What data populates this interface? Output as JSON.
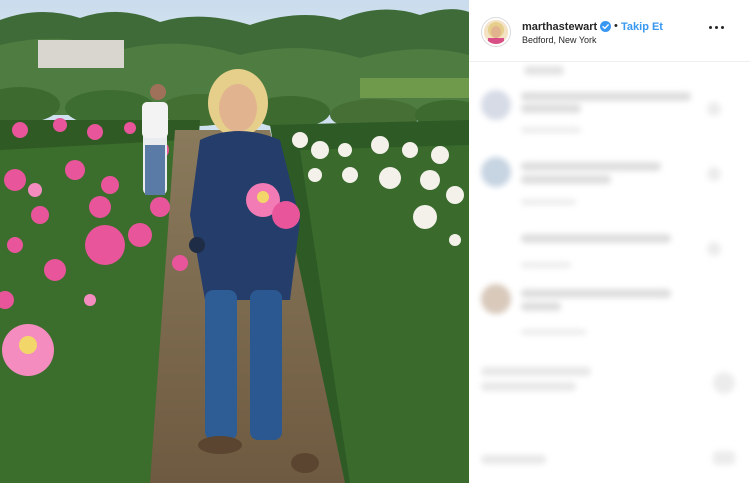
{
  "post": {
    "username": "marthastewart",
    "verified": true,
    "separator": "•",
    "follow_label": "Takip Et",
    "location": "Bedford, New York",
    "more_icon": "more-horizontal-icon"
  },
  "colors": {
    "follow_blue": "#3897f0",
    "verified_blue": "#3897f0",
    "text": "#262626",
    "divider": "#efefef"
  }
}
